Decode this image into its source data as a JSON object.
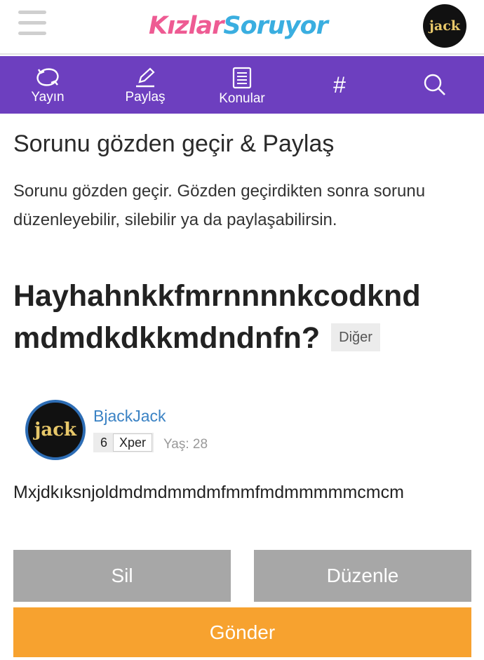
{
  "header": {
    "logo_part1": "Kızlar",
    "logo_part2": "Soruyor",
    "avatar_text": "jack"
  },
  "nav": {
    "items": [
      {
        "label": "Yayın",
        "icon": "refresh-icon"
      },
      {
        "label": "Paylaş",
        "icon": "pencil-icon"
      },
      {
        "label": "Konular",
        "icon": "document-list-icon"
      },
      {
        "label": "",
        "icon": "hash-icon"
      },
      {
        "label": "",
        "icon": "search-icon"
      }
    ],
    "hash_symbol": "#"
  },
  "page": {
    "title": "Sorunu gözden geçir & Paylaş",
    "intro": "Sorunu gözden geçir. Gözden geçirdikten sonra sorunu düzenleyebilir, silebilir ya da paylaşabilirsin."
  },
  "question": {
    "title": "Hayhahnkkfmrnnnnkcodknd mdmdkdkkmdndnfn?",
    "category": "Diğer",
    "author": {
      "avatar_text": "jack",
      "name": "BjackJack",
      "xp_value": "6",
      "xp_label": "Xper",
      "age": "Yaş: 28"
    },
    "body": "Mxjdkıksnjoldmdmdmmdmfmmfmdmmmmmcmcm"
  },
  "actions": {
    "delete_label": "Sil",
    "edit_label": "Düzenle",
    "send_label": "Gönder"
  },
  "colors": {
    "nav_bg": "#6d3fbf",
    "send_button": "#f7a22f",
    "secondary_button": "#a7a7a7",
    "username_link": "#3a82c4"
  }
}
